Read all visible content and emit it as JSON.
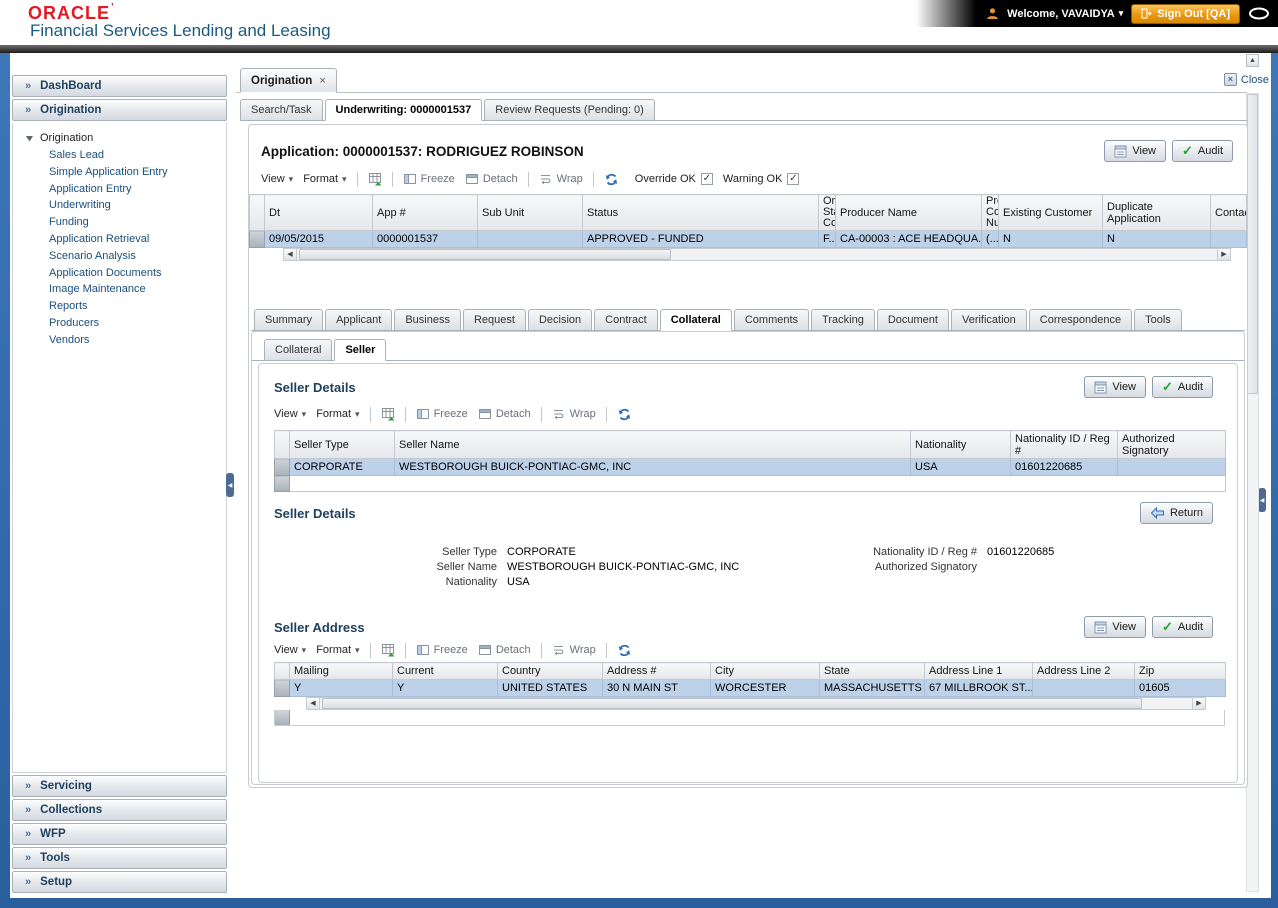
{
  "header": {
    "logo": "ORACLE",
    "logo_mark": "’",
    "subtitle": "Financial Services Lending and Leasing",
    "welcome": "Welcome, VAVAIDYA",
    "signout": "Sign Out [QA]"
  },
  "icons": {
    "chevron_right": "»",
    "dropdown": "▾",
    "check": "✓",
    "tab_close": "×",
    "close_x": "×",
    "left_arrow": "◀",
    "right_arrow": "▶",
    "up_arrow": "▲"
  },
  "sidebar": {
    "panels": {
      "dashboard": "DashBoard",
      "origination": "Origination",
      "servicing": "Servicing",
      "collections": "Collections",
      "wfp": "WFP",
      "tools": "Tools",
      "setup": "Setup"
    },
    "tree": {
      "root": "Origination",
      "items": [
        "Sales Lead",
        "Simple Application Entry",
        "Application Entry",
        "Underwriting",
        "Funding",
        "Application Retrieval",
        "Scenario Analysis",
        "Application Documents",
        "Image Maintenance",
        "Reports",
        "Producers",
        "Vendors"
      ]
    }
  },
  "workspace": {
    "tab_label": "Origination",
    "close_label": "Close",
    "tabs": [
      "Search/Task",
      "Underwriting: 0000001537",
      "Review Requests (Pending: 0)"
    ]
  },
  "toolbar": {
    "view": "View",
    "format": "Format",
    "freeze": "Freeze",
    "detach": "Detach",
    "wrap": "Wrap"
  },
  "buttons": {
    "view": "View",
    "audit": "Audit",
    "return": "Return"
  },
  "application": {
    "title": "Application: 0000001537: RODRIGUEZ ROBINSON",
    "override_ok": "Override OK",
    "warning_ok": "Warning OK",
    "columns": [
      "Dt",
      "App #",
      "Sub Unit",
      "Status",
      "Ori\nSta\nCo",
      "Producer Name",
      "Prc\nCo\nNu",
      "Existing Customer",
      "Duplicate Application",
      "Contact"
    ],
    "row": [
      "09/05/2015",
      "0000001537",
      "",
      "APPROVED - FUNDED",
      "F...",
      "CA-00003 : ACE HEADQUA...",
      "(...",
      "N",
      "N",
      ""
    ]
  },
  "detail_tabs": [
    "Summary",
    "Applicant",
    "Business",
    "Request",
    "Decision",
    "Contract",
    "Collateral",
    "Comments",
    "Tracking",
    "Document",
    "Verification",
    "Correspondence",
    "Tools"
  ],
  "collateral_tabs": [
    "Collateral",
    "Seller"
  ],
  "seller_details": {
    "title": "Seller Details",
    "columns": [
      "Seller Type",
      "Seller Name",
      "Nationality",
      "Nationality ID / Reg #",
      "Authorized Signatory"
    ],
    "row": [
      "CORPORATE",
      "WESTBOROUGH BUICK-PONTIAC-GMC, INC",
      "USA",
      "01601220685",
      ""
    ]
  },
  "seller_form": {
    "title": "Seller Details",
    "labels": {
      "seller_type": "Seller Type",
      "seller_name": "Seller Name",
      "nationality": "Nationality",
      "nat_id": "Nationality ID / Reg #",
      "auth_sig": "Authorized Signatory"
    },
    "values": {
      "seller_type": "CORPORATE",
      "seller_name": "WESTBOROUGH BUICK-PONTIAC-GMC, INC",
      "nationality": "USA",
      "nat_id": "01601220685",
      "auth_sig": ""
    }
  },
  "seller_address": {
    "title": "Seller Address",
    "columns": [
      "Mailing",
      "Current",
      "Country",
      "Address #",
      "City",
      "State",
      "Address Line 1",
      "Address Line 2",
      "Zip"
    ],
    "row": [
      "Y",
      "Y",
      "UNITED STATES",
      "30 N MAIN ST",
      "WORCESTER",
      "MASSACHUSETTS",
      "67 MILLBROOK ST...",
      "",
      "01605"
    ]
  },
  "colors": {
    "oracle_red": "#e21b22",
    "brand_blue": "#1b5a80",
    "frame_blue": "#2f6aab",
    "selected_row": "#bdd2e9",
    "signout_orange": "#ea9712",
    "heading_navy": "#1d3f5e"
  }
}
